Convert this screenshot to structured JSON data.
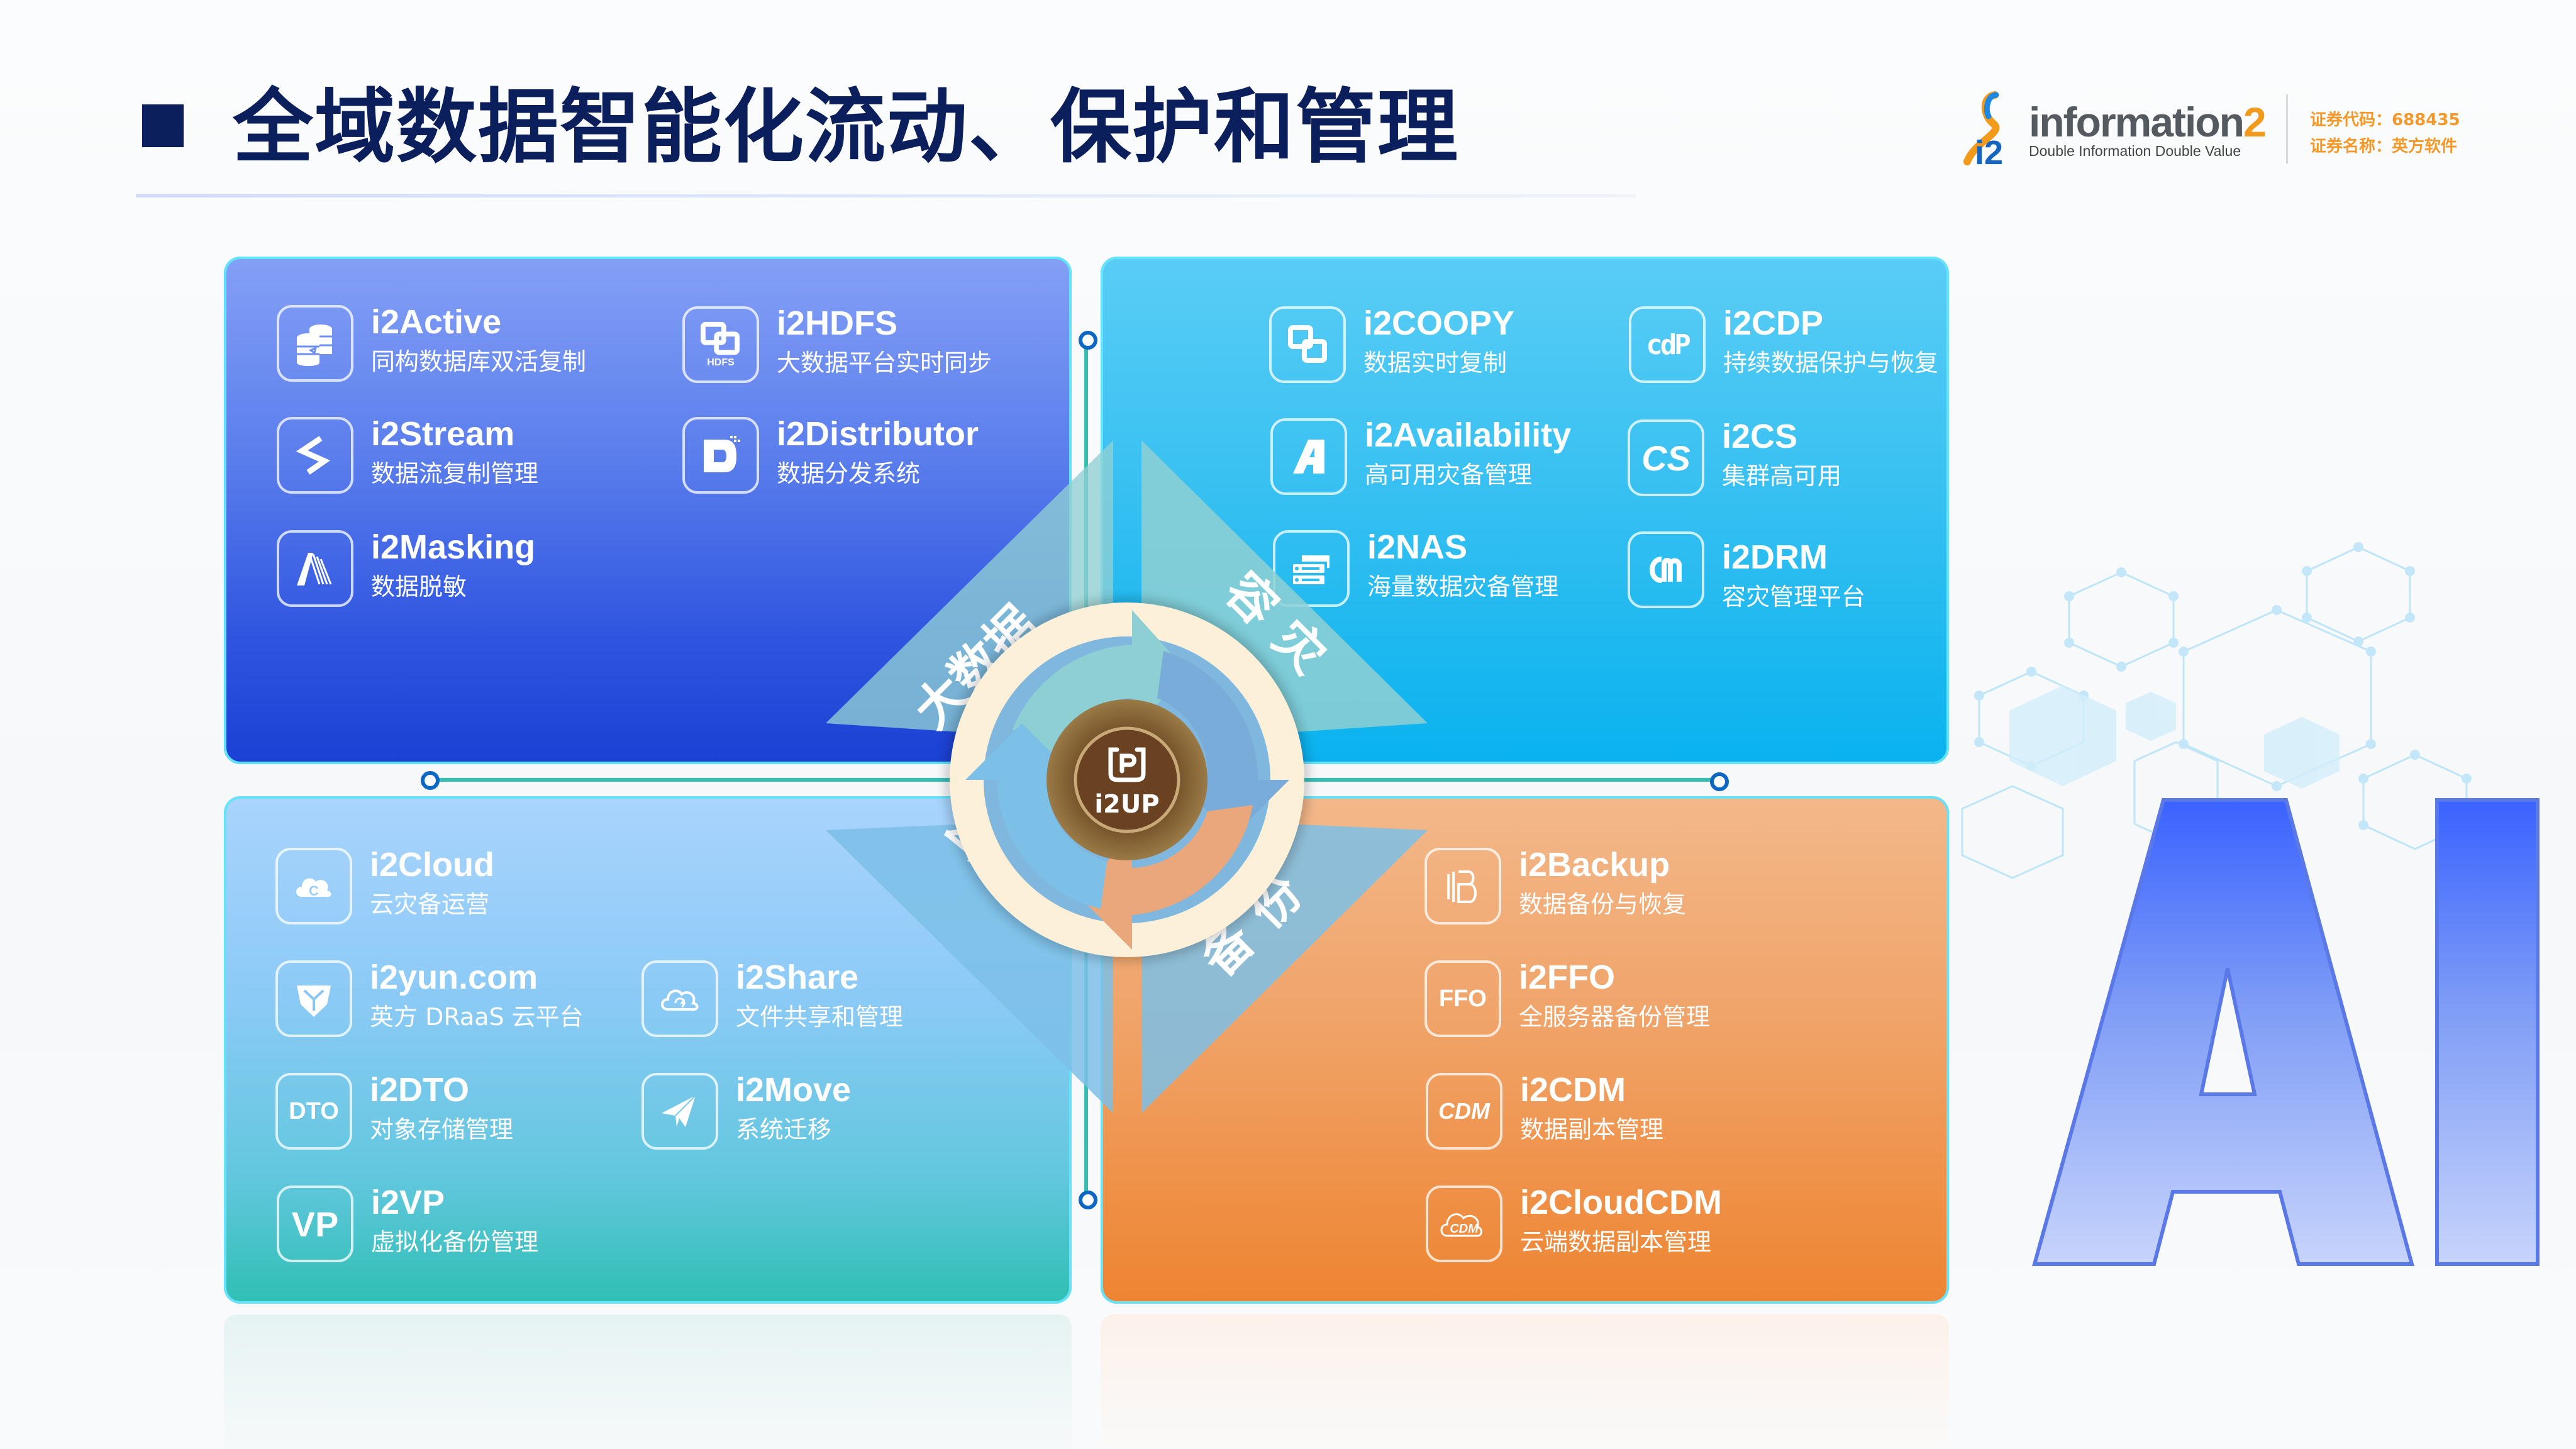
{
  "header": {
    "title": "全域数据智能化流动、保护和管理",
    "logo": {
      "wordmark_main": "information",
      "wordmark_suffix": "2",
      "mark_text": "i2",
      "tagline": "Double Information Double Value"
    },
    "stock_code_line": "证券代码：688435",
    "stock_name_line": "证券名称：英方软件"
  },
  "colors": {
    "title": "#0b1f5c",
    "big_data_panel": "#2f55e0",
    "dr_panel": "#09b2ef",
    "cloud_dr_panel": "#2fbfb4",
    "backup_panel": "#ee8431",
    "connector_line": "#33c0b3",
    "connector_dot": "#0c66c3",
    "logo_orange": "#f29a1c"
  },
  "center": {
    "hub_label": "i2UP",
    "hub_icon": "p-bracket-icon",
    "segments": [
      {
        "label": "大数据",
        "position": "top-left"
      },
      {
        "label": "容灾",
        "position": "top-right"
      },
      {
        "label": "云灾备",
        "position": "bottom-left"
      },
      {
        "label": "备份",
        "position": "bottom-right"
      }
    ]
  },
  "panels": {
    "big_data": {
      "items": [
        {
          "name": "i2Active",
          "desc": "同构数据库双活复制",
          "icon": "database-sync-icon"
        },
        {
          "name": "i2HDFS",
          "desc": "大数据平台实时同步",
          "icon": "hdfs-icon",
          "icon_caption": "HDFS"
        },
        {
          "name": "i2Stream",
          "desc": "数据流复制管理",
          "icon": "stream-s-icon"
        },
        {
          "name": "i2Distributor",
          "desc": "数据分发系统",
          "icon": "distributor-d-icon"
        },
        {
          "name": "i2Masking",
          "desc": "数据脱敏",
          "icon": "masking-m-icon"
        }
      ]
    },
    "disaster_recovery": {
      "items": [
        {
          "name": "i2COOPY",
          "desc": "数据实时复制",
          "icon": "linked-squares-icon"
        },
        {
          "name": "i2CDP",
          "desc": "持续数据保护与恢复",
          "icon": "cdp-text-icon",
          "icon_text": "cdP"
        },
        {
          "name": "i2Availability",
          "desc": "高可用灾备管理",
          "icon": "availability-a-icon"
        },
        {
          "name": "i2CS",
          "desc": "集群高可用",
          "icon": "cs-text-icon",
          "icon_text": "CS"
        },
        {
          "name": "i2NAS",
          "desc": "海量数据灾备管理",
          "icon": "nas-server-icon"
        },
        {
          "name": "i2DRM",
          "desc": "容灾管理平台",
          "icon": "drm-icon"
        }
      ]
    },
    "cloud_dr": {
      "items": [
        {
          "name": "i2Cloud",
          "desc": "云灾备运营",
          "icon": "cloud-c-icon"
        },
        {
          "name": "i2yun.com",
          "desc": "英方 DRaaS 云平台",
          "icon": "yun-shield-icon"
        },
        {
          "name": "i2Share",
          "desc": "文件共享和管理",
          "icon": "cloud-sync-icon"
        },
        {
          "name": "i2DTO",
          "desc": "对象存储管理",
          "icon": "dto-text-icon",
          "icon_text": "DTO"
        },
        {
          "name": "i2Move",
          "desc": "系统迁移",
          "icon": "paper-plane-icon"
        },
        {
          "name": "i2VP",
          "desc": "虚拟化备份管理",
          "icon": "vp-text-icon",
          "icon_text": "VP"
        }
      ]
    },
    "backup": {
      "items": [
        {
          "name": "i2Backup",
          "desc": "数据备份与恢复",
          "icon": "backup-b-icon"
        },
        {
          "name": "i2FFO",
          "desc": "全服务器备份管理",
          "icon": "ffo-text-icon",
          "icon_text": "FFO"
        },
        {
          "name": "i2CDM",
          "desc": "数据副本管理",
          "icon": "cdm-text-icon",
          "icon_text": "CDM"
        },
        {
          "name": "i2CloudCDM",
          "desc": "云端数据副本管理",
          "icon": "cloud-cdm-icon",
          "icon_text": "CDM"
        }
      ]
    }
  },
  "decoration": {
    "ai_text": "AI"
  }
}
